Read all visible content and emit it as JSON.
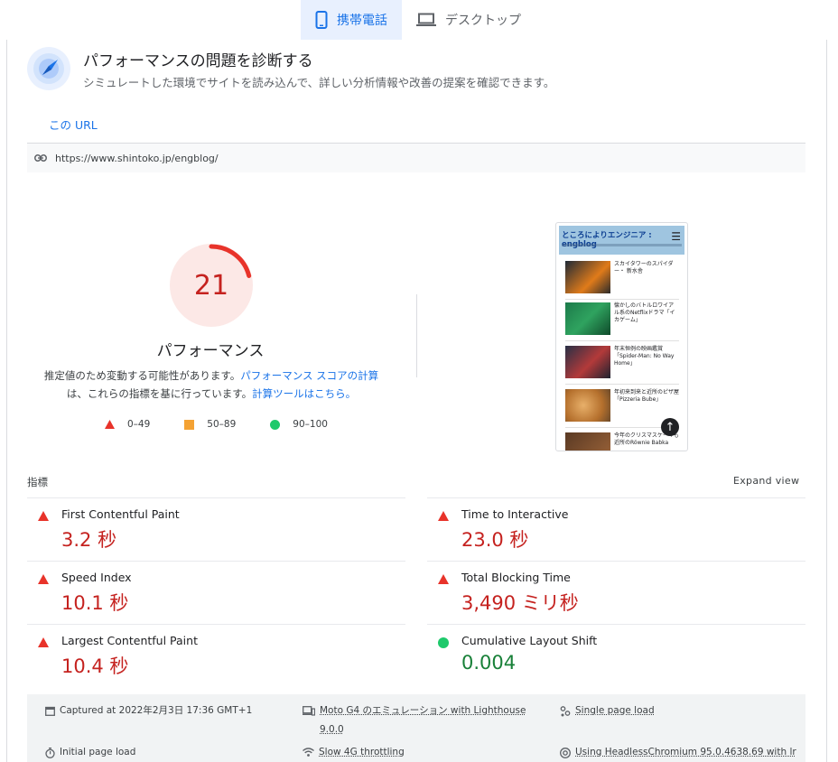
{
  "device_tabs": [
    {
      "label": "携帯電話",
      "icon": "smartphone-icon",
      "active": true
    },
    {
      "label": "デスクトップ",
      "icon": "laptop-icon",
      "active": false
    }
  ],
  "diagnose": {
    "title": "パフォーマンスの問題を診断する",
    "subtitle": "シミュレートした環境でサイトを読み込んで、詳しい分析情報や改善の提案を確認できます。"
  },
  "url_tab": "この URL",
  "url": "https://www.shintoko.jp/engblog/",
  "score": {
    "value": "21",
    "fraction": 0.21,
    "label": "パフォーマンス",
    "desc_1": "推定値のため変動する可能性があります。",
    "desc_link_1": "パフォーマンス スコアの計算",
    "desc_2": "は、これらの指標を基に行っています。",
    "desc_link_2": "計算ツールはこちら。"
  },
  "legend": [
    "0–49",
    "50–89",
    "90–100"
  ],
  "thumb": {
    "site_title": "ところによりエンジニア : engblog",
    "posts": [
      "スカイタワーのスパイダー・ 新水舎",
      "懐かしのバトルロワイアル系のNetflixドラマ「イカゲーム」",
      "年末恒例の映画鑑賞「Spider-Man: No Way Home」",
      "年初来到来と近所のピザ屋「Pizzeria Bube」",
      "今年のクリスマスケーキも近所のRöwnie Babka"
    ]
  },
  "metrics_label": "指標",
  "expand_label": "Expand view",
  "metrics": [
    {
      "name": "First Contentful Paint",
      "value": "3.2 秒",
      "status": "poor"
    },
    {
      "name": "Time to Interactive",
      "value": "23.0 秒",
      "status": "poor"
    },
    {
      "name": "Speed Index",
      "value": "10.1 秒",
      "status": "poor"
    },
    {
      "name": "Total Blocking Time",
      "value": "3,490 ミリ秒",
      "status": "poor"
    },
    {
      "name": "Largest Contentful Paint",
      "value": "10.4 秒",
      "status": "poor"
    },
    {
      "name": "Cumulative Layout Shift",
      "value": "0.004",
      "status": "good"
    }
  ],
  "run_info": {
    "captured": "Captured at 2022年2月3日 17:36 GMT+1",
    "device": "Moto G4 のエミュレーション with Lighthouse",
    "device_version": "9.0.0",
    "load_type": "Single page load",
    "initial": "Initial page load",
    "throttling": "Slow 4G throttling",
    "browser": "Using HeadlessChromium 95.0.4638.69 with lr"
  },
  "colors": {
    "poor": "#e8332a",
    "average": "#f4a233",
    "good": "#1ec96b",
    "accent": "#1a73e8"
  }
}
